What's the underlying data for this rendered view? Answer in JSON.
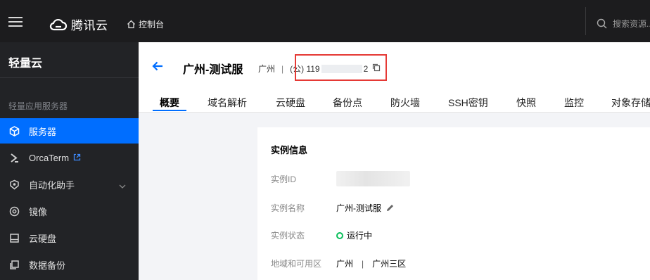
{
  "topbar": {
    "brand": "腾讯云",
    "console_label": "控制台",
    "search_placeholder": "搜索资源..."
  },
  "sidebar": {
    "title": "轻量云",
    "section_label": "轻量应用服务器",
    "items": [
      {
        "label": "服务器",
        "icon": "cube-icon",
        "active": true
      },
      {
        "label": "OrcaTerm",
        "icon": "terminal-icon",
        "external": true
      },
      {
        "label": "自动化助手",
        "icon": "automation-icon",
        "has_children": true
      },
      {
        "label": "镜像",
        "icon": "disc-icon"
      },
      {
        "label": "云硬盘",
        "icon": "disk-icon"
      },
      {
        "label": "数据备份",
        "icon": "backup-icon"
      }
    ]
  },
  "instance": {
    "name": "广州-测试服",
    "region": "广州",
    "ip_prefix": "(公) 119",
    "ip_suffix": "2"
  },
  "tabs": [
    "概要",
    "域名解析",
    "云硬盘",
    "备份点",
    "防火墙",
    "SSH密钥",
    "快照",
    "监控",
    "对象存储"
  ],
  "active_tab": "概要",
  "info_card": {
    "title": "实例信息",
    "id_label": "实例ID",
    "name_label": "实例名称",
    "name_value": "广州-测试服",
    "status_label": "实例状态",
    "status_value": "运行中",
    "zone_label": "地域和可用区",
    "region_value": "广州",
    "zone_value": "广州三区"
  },
  "colors": {
    "accent": "#006eff",
    "status_green": "#0abf5b",
    "highlight_red": "#e53935"
  }
}
